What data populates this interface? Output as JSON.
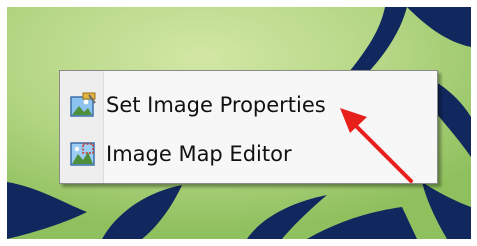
{
  "context_menu": {
    "items": [
      {
        "label": "Set Image Properties",
        "icon": "set-image-properties-icon"
      },
      {
        "label": "Image Map Editor",
        "icon": "image-map-editor-icon"
      }
    ]
  },
  "annotation": {
    "arrow_color": "#e8201c",
    "points_to": "Set Image Properties"
  },
  "colors": {
    "background_green": "#a9cf79",
    "leaf_navy": "#10285e",
    "menu_background": "#f7f7f7"
  }
}
